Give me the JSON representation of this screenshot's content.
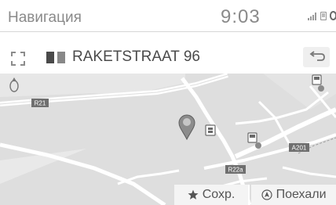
{
  "status_bar": {
    "app_title": "Навигация",
    "clock": "9:03",
    "icons": [
      "signal-icon",
      "phone-icon",
      "bluetooth-icon"
    ]
  },
  "address_bar": {
    "address": "RAKETSTRAAT 96",
    "icons": [
      "expand-icon",
      "flag-icon",
      "back-arrow-icon"
    ]
  },
  "map": {
    "road_labels": [
      {
        "id": "r21",
        "text": "R21"
      },
      {
        "id": "a201",
        "text": "A201"
      },
      {
        "id": "r22a",
        "text": "R22a"
      }
    ]
  },
  "actions": {
    "save_label": "Сохр.",
    "go_label": "Поехали"
  }
}
